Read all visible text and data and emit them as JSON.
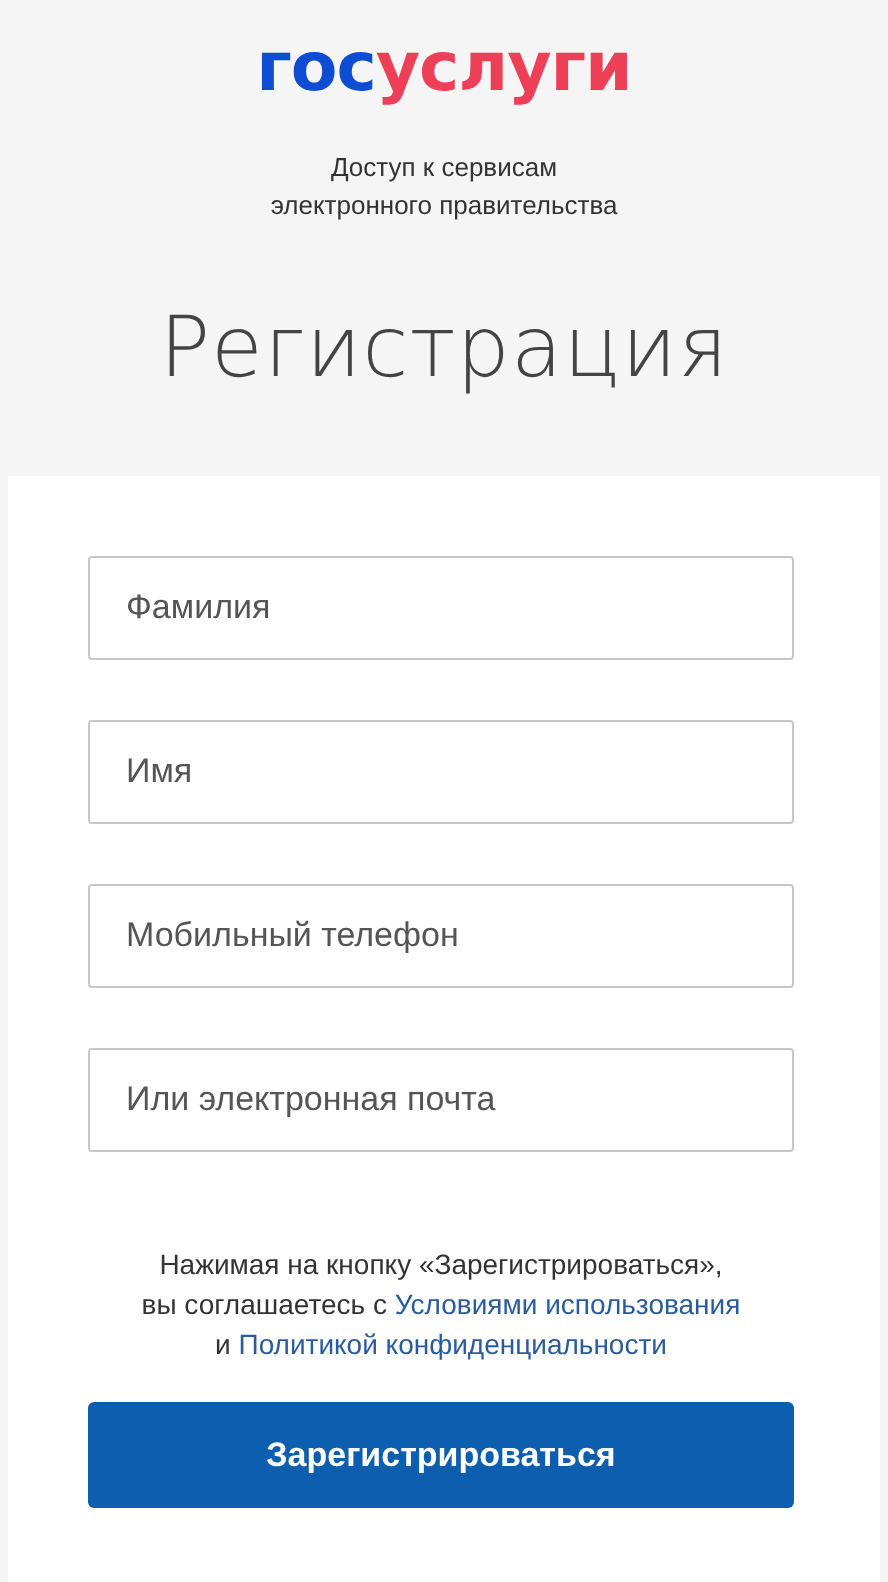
{
  "logo": {
    "parts": [
      {
        "text": "гос",
        "color": "#0d4cd3"
      },
      {
        "text": "услуги",
        "color": "#ee3f58"
      }
    ]
  },
  "tagline": [
    "Доступ к сервисам",
    "электронного правительства"
  ],
  "title": "Регистрация",
  "fields": [
    {
      "placeholder": "Фамилия"
    },
    {
      "placeholder": "Имя"
    },
    {
      "placeholder": "Мобильный телефон"
    },
    {
      "placeholder": "Или электронная почта"
    }
  ],
  "terms": {
    "lines": [
      [
        {
          "kind": "text",
          "text": "Нажимая на кнопку «Зарегистрироваться»,"
        }
      ],
      [
        {
          "kind": "text",
          "text": "вы соглашаетесь с "
        },
        {
          "kind": "link",
          "text": "Условиями использования"
        }
      ],
      [
        {
          "kind": "text",
          "text": "и "
        },
        {
          "kind": "link",
          "text": "Политикой конфиденциальности"
        }
      ]
    ]
  },
  "submit": "Зарегистрироваться"
}
